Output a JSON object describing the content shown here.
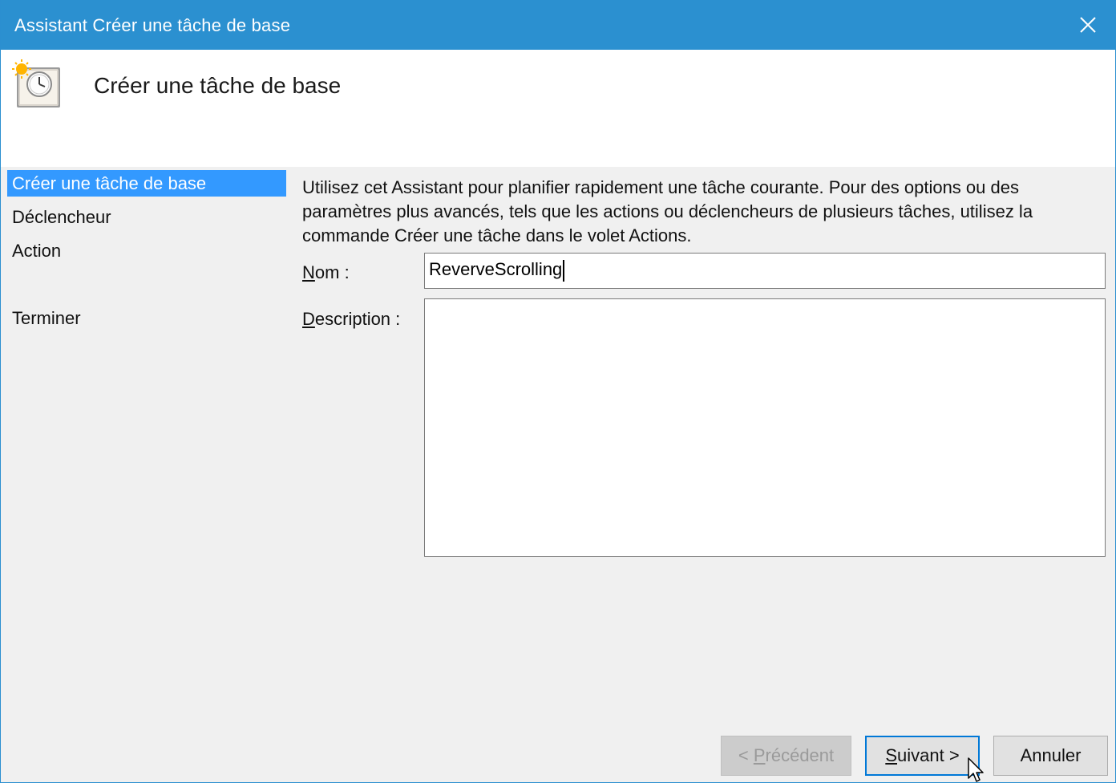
{
  "window": {
    "title": "Assistant Créer une tâche de base",
    "close_label": "close",
    "accent_color": "#2b90d0"
  },
  "header": {
    "title": "Créer une tâche de base",
    "icon": "task-scheduler-clock-icon"
  },
  "sidebar": {
    "items": [
      {
        "label": "Créer une tâche de base",
        "active": true
      },
      {
        "label": "Déclencheur",
        "active": false
      },
      {
        "label": "Action",
        "active": false
      },
      {
        "label": "Terminer",
        "active": false
      }
    ],
    "selection_color": "#3399ff"
  },
  "main": {
    "intro": "Utilisez cet Assistant pour planifier rapidement une tâche courante. Pour des options ou des paramètres plus avancés, tels que les actions ou déclencheurs de plusieurs tâches, utilisez la commande Créer une tâche dans le volet Actions.",
    "name_label_mnemonic": "N",
    "name_label_rest": "om :",
    "name_value": "ReverveScrolling",
    "description_label_mnemonic": "D",
    "description_label_rest": "escription :",
    "description_value": ""
  },
  "buttons": {
    "previous_prefix": "< ",
    "previous_mnemonic": "P",
    "previous_rest": "récédent",
    "previous_enabled": false,
    "next_mnemonic": "S",
    "next_rest": "uivant >",
    "cancel": "Annuler"
  }
}
